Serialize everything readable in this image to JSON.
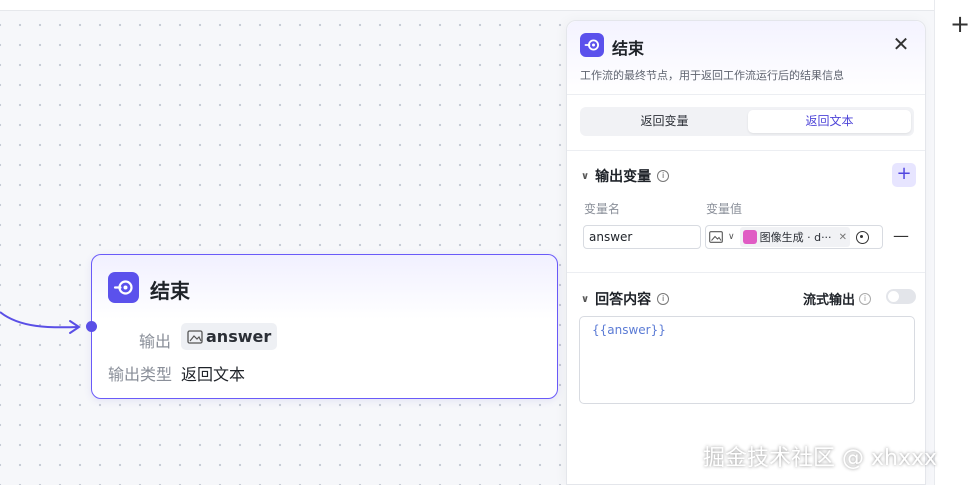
{
  "node": {
    "title": "结束",
    "output_label": "输出",
    "output_var": "answer",
    "output_type_label": "输出类型",
    "output_type_value": "返回文本"
  },
  "panel": {
    "title": "结束",
    "description": "工作流的最终节点，用于返回工作流运行后的结果信息",
    "tabs": [
      "返回变量",
      "返回文本"
    ],
    "active_tab": "返回文本",
    "output_section": {
      "title": "输出变量",
      "columns": [
        "变量名",
        "变量值"
      ],
      "rows": [
        {
          "name": "answer",
          "value": "图像生成 · d···"
        }
      ]
    },
    "answer_section": {
      "title": "回答内容",
      "stream_label": "流式输出",
      "stream_enabled": false,
      "content": "{{answer}}"
    }
  },
  "watermark": "掘金技术社区 @ xhxxx",
  "colors": {
    "accent": "#5b51ec",
    "node_border": "#6a5af9",
    "pink_icon": "#e05bc4"
  }
}
